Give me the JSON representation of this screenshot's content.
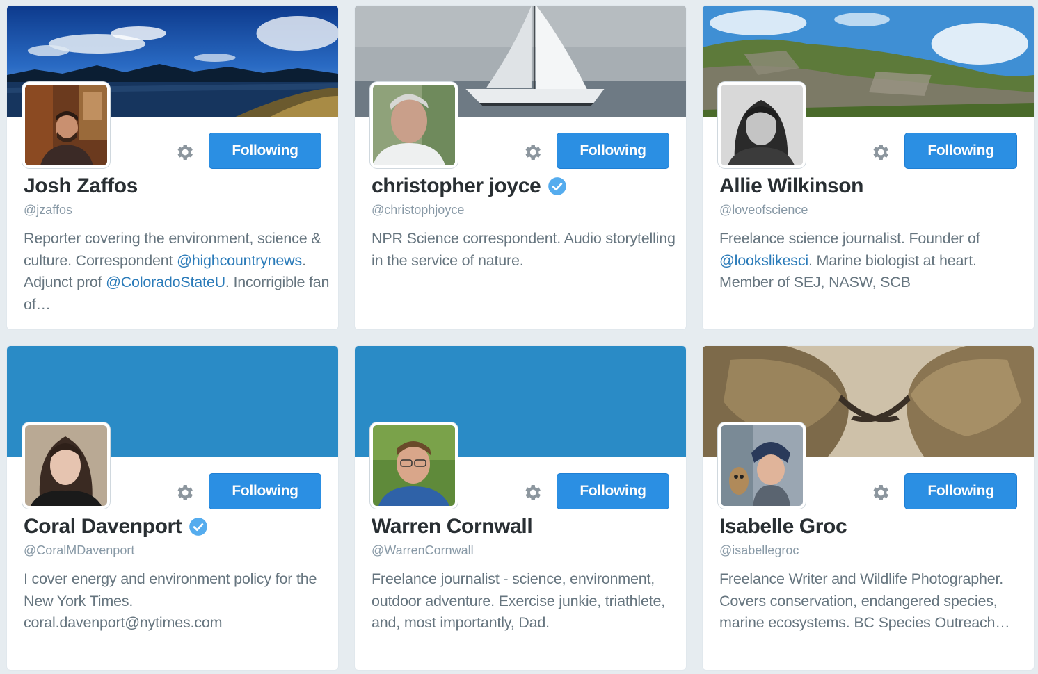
{
  "colors": {
    "accent_blue": "#2b8fe3",
    "plain_banner_blue": "#2a8bc6",
    "verified_blue": "#55acee",
    "mention_blue": "#2b7bb9"
  },
  "cards": [
    {
      "name": "Josh Zaffos",
      "handle": "@jzaffos",
      "verified": false,
      "follow_label": "Following",
      "settings_icon": "gear-icon",
      "bio": [
        {
          "text": "Reporter covering the environment, science & culture. Correspondent "
        },
        {
          "mention": "@highcountrynews"
        },
        {
          "text": ". Adjunct prof "
        },
        {
          "mention": "@ColoradoStateU"
        },
        {
          "text": ". Incorrigible fan of…"
        }
      ]
    },
    {
      "name": "christopher joyce",
      "handle": "@christophjoyce",
      "verified": true,
      "follow_label": "Following",
      "settings_icon": "gear-icon",
      "bio": [
        {
          "text": "NPR Science correspondent. Audio storytelling in the service of nature."
        }
      ]
    },
    {
      "name": "Allie Wilkinson",
      "handle": "@loveofscience",
      "verified": false,
      "follow_label": "Following",
      "settings_icon": "gear-icon",
      "bio": [
        {
          "text": "Freelance science journalist. Founder of "
        },
        {
          "mention": "@lookslikesci"
        },
        {
          "text": ". Marine biologist at heart. Member of SEJ, NASW, SCB"
        }
      ]
    },
    {
      "name": "Coral Davenport",
      "handle": "@CoralMDavenport",
      "verified": true,
      "follow_label": "Following",
      "settings_icon": "gear-icon",
      "bio": [
        {
          "text": "I cover energy and environment policy for the New York Times. coral.davenport@nytimes.com"
        }
      ]
    },
    {
      "name": "Warren Cornwall",
      "handle": "@WarrenCornwall",
      "verified": false,
      "follow_label": "Following",
      "settings_icon": "gear-icon",
      "bio": [
        {
          "text": "Freelance journalist - science, environment, outdoor adventure. Exercise junkie, triathlete, and, most importantly, Dad."
        }
      ]
    },
    {
      "name": "Isabelle Groc",
      "handle": "@isabellegroc",
      "verified": false,
      "follow_label": "Following",
      "settings_icon": "gear-icon",
      "bio": [
        {
          "text": "Freelance Writer and Wildlife Photographer. Covers conservation, endangered species, marine ecosystems. BC Species Outreach…"
        }
      ]
    }
  ]
}
